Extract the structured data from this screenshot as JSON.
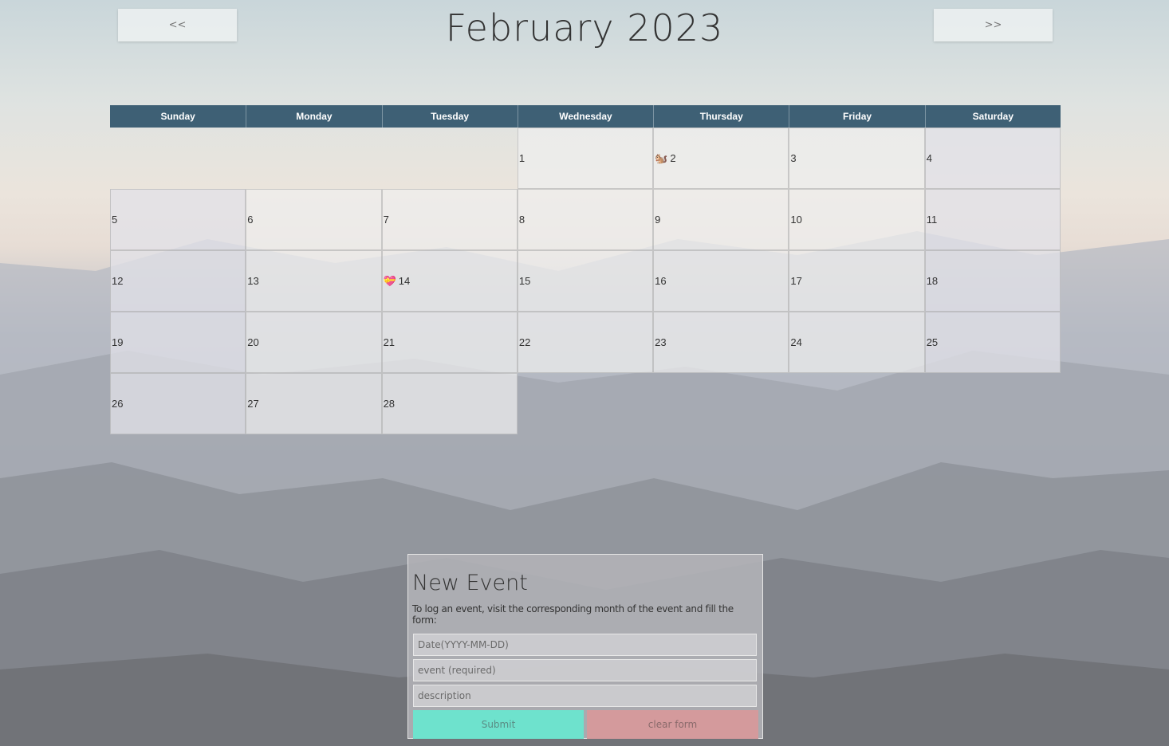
{
  "header": {
    "prev_label": "<<",
    "next_label": ">>",
    "month_title": "February 2023"
  },
  "weekdays": [
    "Sunday",
    "Monday",
    "Tuesday",
    "Wednesday",
    "Thursday",
    "Friday",
    "Saturday"
  ],
  "days": [
    {
      "n": "",
      "emoji": ""
    },
    {
      "n": "",
      "emoji": ""
    },
    {
      "n": "",
      "emoji": ""
    },
    {
      "n": "1",
      "emoji": ""
    },
    {
      "n": "2",
      "emoji": "🐿️"
    },
    {
      "n": "3",
      "emoji": ""
    },
    {
      "n": "4",
      "emoji": ""
    },
    {
      "n": "5",
      "emoji": ""
    },
    {
      "n": "6",
      "emoji": ""
    },
    {
      "n": "7",
      "emoji": ""
    },
    {
      "n": "8",
      "emoji": ""
    },
    {
      "n": "9",
      "emoji": ""
    },
    {
      "n": "10",
      "emoji": ""
    },
    {
      "n": "11",
      "emoji": ""
    },
    {
      "n": "12",
      "emoji": ""
    },
    {
      "n": "13",
      "emoji": ""
    },
    {
      "n": "14",
      "emoji": "💝"
    },
    {
      "n": "15",
      "emoji": ""
    },
    {
      "n": "16",
      "emoji": ""
    },
    {
      "n": "17",
      "emoji": ""
    },
    {
      "n": "18",
      "emoji": ""
    },
    {
      "n": "19",
      "emoji": ""
    },
    {
      "n": "20",
      "emoji": ""
    },
    {
      "n": "21",
      "emoji": ""
    },
    {
      "n": "22",
      "emoji": ""
    },
    {
      "n": "23",
      "emoji": ""
    },
    {
      "n": "24",
      "emoji": ""
    },
    {
      "n": "25",
      "emoji": ""
    },
    {
      "n": "26",
      "emoji": ""
    },
    {
      "n": "27",
      "emoji": ""
    },
    {
      "n": "28",
      "emoji": ""
    }
  ],
  "form": {
    "title": "New Event",
    "hint": "To log an event, visit the corresponding month of the event and fill the form:",
    "date_placeholder": "Date(YYYY-MM-DD)",
    "event_placeholder": "event (required)",
    "description_placeholder": "description",
    "submit_label": "Submit",
    "clear_label": "clear form"
  },
  "colors": {
    "header_bar": "#3e6075",
    "submit": "#6ee2cd",
    "clear": "#d49a9c"
  }
}
